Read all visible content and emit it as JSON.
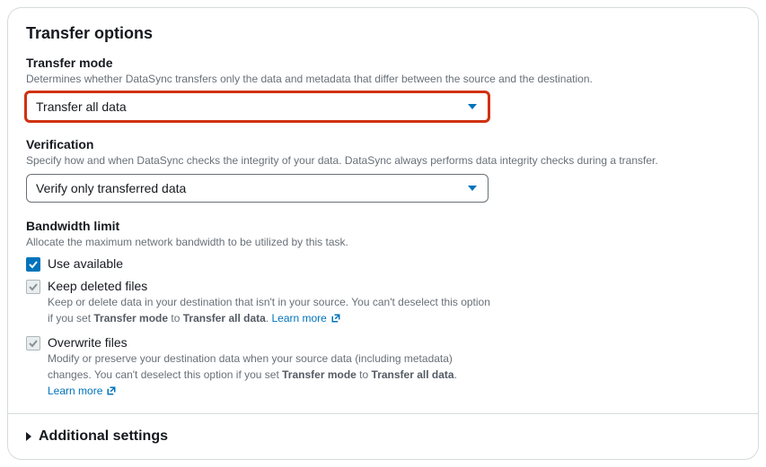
{
  "section_title": "Transfer options",
  "transfer_mode": {
    "label": "Transfer mode",
    "description": "Determines whether DataSync transfers only the data and metadata that differ between the source and the destination.",
    "selected": "Transfer all data"
  },
  "verification": {
    "label": "Verification",
    "description": "Specify how and when DataSync checks the integrity of your data. DataSync always performs data integrity checks during a transfer.",
    "selected": "Verify only transferred data"
  },
  "bandwidth": {
    "label": "Bandwidth limit",
    "description": "Allocate the maximum network bandwidth to be utilized by this task.",
    "use_available": "Use available"
  },
  "keep_deleted": {
    "label": "Keep deleted files",
    "desc_a": "Keep or delete data in your destination that isn't in your source. You can't deselect this option if you set ",
    "desc_b": "Transfer mode",
    "desc_c": " to ",
    "desc_d": "Transfer all data",
    "desc_e": ". ",
    "learn_more": "Learn more"
  },
  "overwrite": {
    "label": "Overwrite files",
    "desc_a": "Modify or preserve your destination data when your source data (including metadata) changes. You can't deselect this option if you set ",
    "desc_b": "Transfer mode",
    "desc_c": " to ",
    "desc_d": "Transfer all data",
    "desc_e": ".",
    "learn_more": "Learn more"
  },
  "additional": "Additional settings"
}
